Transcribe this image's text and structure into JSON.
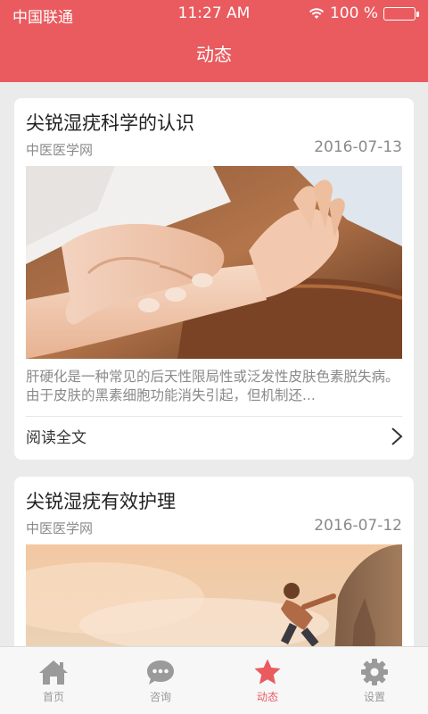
{
  "status_bar": {
    "carrier": "中国联通",
    "time": "11:27 AM",
    "battery_percent": "100 %"
  },
  "nav": {
    "title": "动态"
  },
  "articles": [
    {
      "title": "尖锐湿疣科学的认识",
      "source": "中医医学网",
      "date": "2016-07-13",
      "summary": "肝硬化是一种常见的后天性限局性或泛发性皮肤色素脱失病。由于皮肤的黑素细胞功能消失引起，但机制还...",
      "read_more": "阅读全文",
      "photo": "pulse-diagnosis-photo"
    },
    {
      "title": "尖锐湿疣有效护理",
      "source": "中医医学网",
      "date": "2016-07-12",
      "photo": "rock-climber-photo"
    }
  ],
  "tabs": [
    {
      "label": "首页",
      "icon": "home-icon",
      "active": false
    },
    {
      "label": "咨询",
      "icon": "chat-icon",
      "active": false
    },
    {
      "label": "动态",
      "icon": "star-icon",
      "active": true
    },
    {
      "label": "设置",
      "icon": "gear-icon",
      "active": false
    }
  ],
  "colors": {
    "brand": "#e95b5f",
    "tab_inactive": "#9a9a9a",
    "background": "#ebebeb"
  }
}
